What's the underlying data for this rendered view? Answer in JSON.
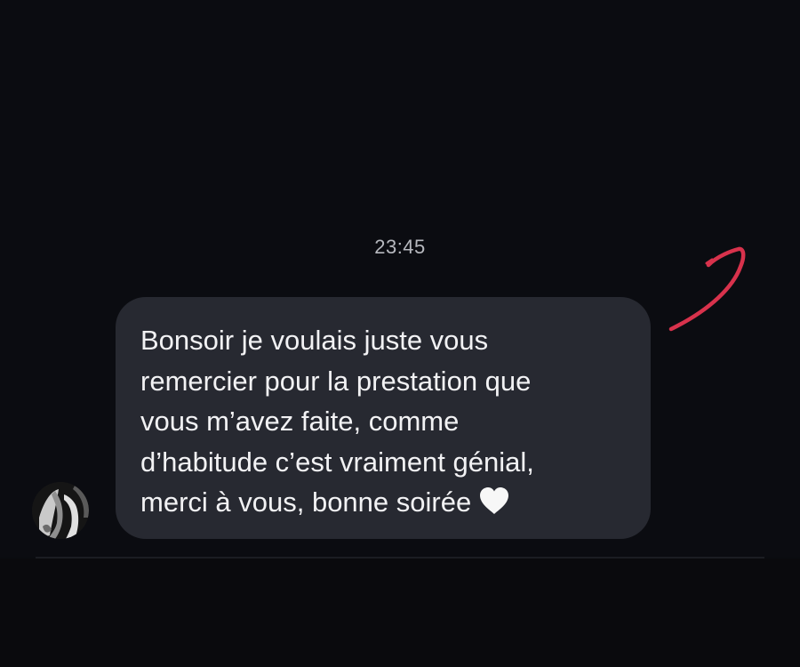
{
  "thread": {
    "timestamp": "23:45"
  },
  "message": {
    "text": "Bonsoir je voulais juste vous\nremercier pour la prestation que\nvous m’avez faite, comme\nd’habitude c’est vraiment génial,\nmerci à vous, bonne soirée",
    "reaction_emoji": "white-heart-icon",
    "bubble_color": "#272931",
    "text_color": "#f2f2f4"
  },
  "sender": {
    "avatar": "avatar"
  },
  "colors": {
    "background": "#0b0c11",
    "annotation_stroke": "#d8324c"
  }
}
